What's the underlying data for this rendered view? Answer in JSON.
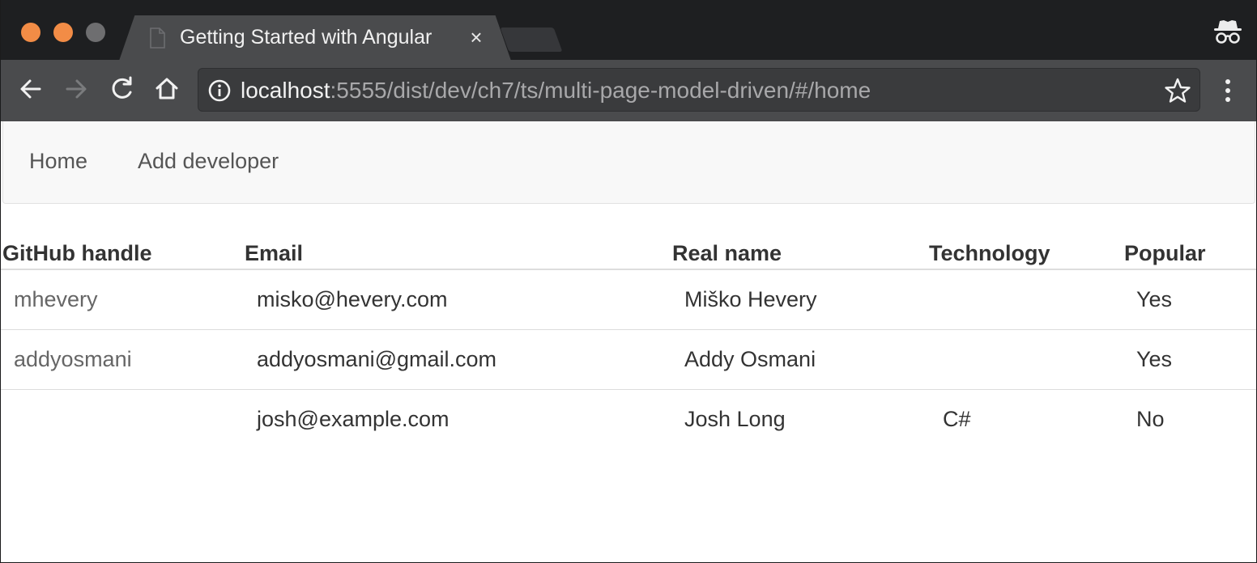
{
  "browser": {
    "tab": {
      "title": "Getting Started with Angular",
      "close_symbol": "×"
    },
    "address_bar": {
      "host": "localhost",
      "path": ":5555/dist/dev/ch7/ts/multi-page-model-driven/#/home"
    },
    "icons": {
      "page": "page-icon",
      "close": "close-icon",
      "incognito": "incognito-icon",
      "back": "back-arrow-icon",
      "forward": "forward-arrow-icon",
      "reload": "reload-icon",
      "home": "home-icon",
      "info": "info-icon",
      "star": "star-icon",
      "menu": "kebab-menu-icon"
    },
    "colors": {
      "traffic_light_active": "#f28c46",
      "traffic_light_inactive": "#6e6e70",
      "chrome_dark": "#1e1f21",
      "toolbar": "#4a4b4d"
    }
  },
  "navbar": {
    "items": [
      {
        "label": "Home"
      },
      {
        "label": "Add developer"
      }
    ]
  },
  "table": {
    "headers": [
      "GitHub handle",
      "Email",
      "Real name",
      "Technology",
      "Popular"
    ],
    "rows": [
      {
        "github": "mhevery",
        "email": "misko@hevery.com",
        "real_name": "Miško Hevery",
        "technology": "",
        "popular": "Yes"
      },
      {
        "github": "addyosmani",
        "email": "addyosmani@gmail.com",
        "real_name": "Addy Osmani",
        "technology": "",
        "popular": "Yes"
      },
      {
        "github": "",
        "email": "josh@example.com",
        "real_name": "Josh Long",
        "technology": "C#",
        "popular": "No"
      }
    ]
  }
}
